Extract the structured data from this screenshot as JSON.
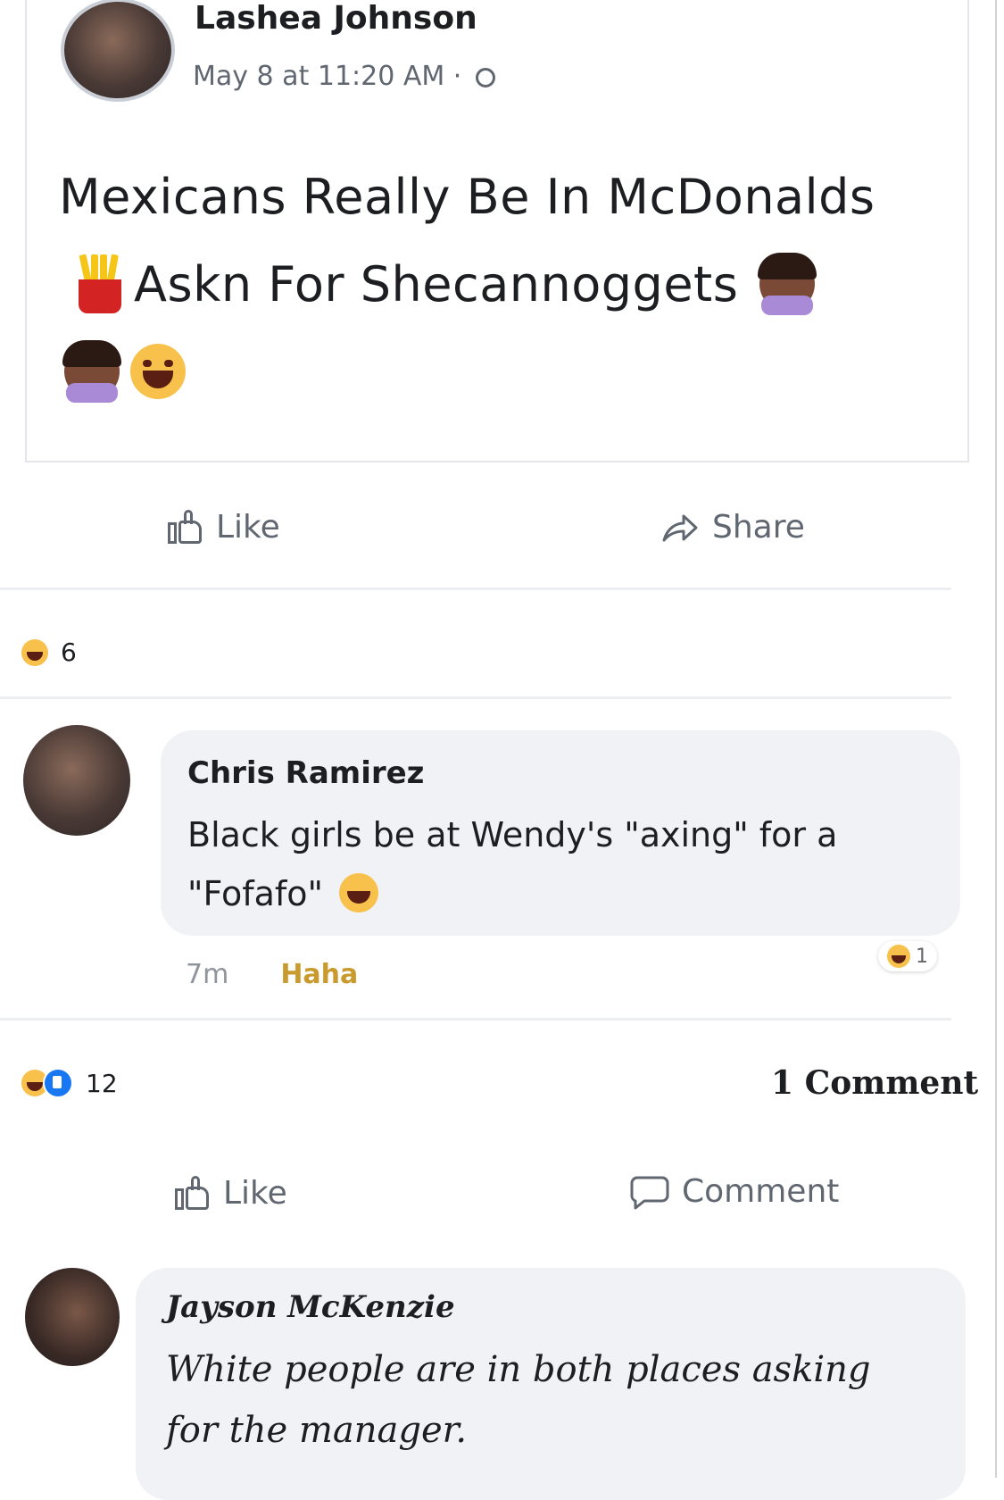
{
  "post": {
    "author": "Lashea Johnson",
    "meta": "May 8 at 11:20 AM · ",
    "privacy_icon": "globe-icon",
    "text_part1": "Mexicans Really Be In McDonalds",
    "text_part2": "Askn For Shecannoggets",
    "emojis": [
      "fries-icon",
      "facepalm-icon",
      "shrug-icon",
      "laughing-icon"
    ]
  },
  "actions_top": {
    "like_label": "Like",
    "share_label": "Share"
  },
  "post_reactions": {
    "count": "6",
    "icon": "haha-icon"
  },
  "comment1": {
    "author": "Chris Ramirez",
    "text_part1": "Black girls be at Wendy's \"axing\" for a \"Fofafo\"",
    "emoji": "laughing-icon",
    "age": "7m",
    "haha_label": "Haha",
    "reaction_count": "1"
  },
  "summary": {
    "reaction_count": "12",
    "comments_label": "1 Comment"
  },
  "actions_bottom": {
    "like_label": "Like",
    "comment_label": "Comment"
  },
  "comment2": {
    "author": "Jayson McKenzie",
    "text": "White people are in both places asking for the manager."
  }
}
